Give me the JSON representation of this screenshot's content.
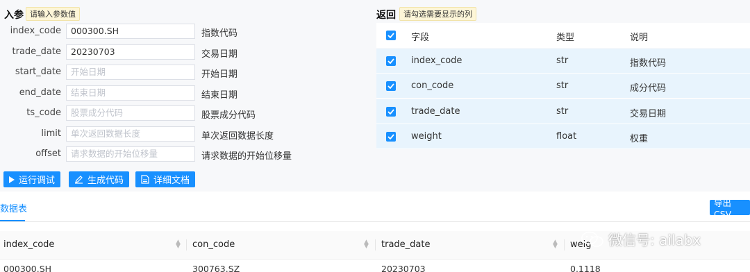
{
  "params": {
    "title": "入参",
    "hint": "请输入参数值",
    "rows": [
      {
        "label": "index_code",
        "value": "000300.SH",
        "placeholder": "",
        "desc": "指数代码"
      },
      {
        "label": "trade_date",
        "value": "20230703",
        "placeholder": "",
        "desc": "交易日期"
      },
      {
        "label": "start_date",
        "value": "",
        "placeholder": "开始日期",
        "desc": "开始日期"
      },
      {
        "label": "end_date",
        "value": "",
        "placeholder": "结束日期",
        "desc": "结束日期"
      },
      {
        "label": "ts_code",
        "value": "",
        "placeholder": "股票成分代码",
        "desc": "股票成分代码"
      },
      {
        "label": "limit",
        "value": "",
        "placeholder": "单次返回数据长度",
        "desc": "单次返回数据长度"
      },
      {
        "label": "offset",
        "value": "",
        "placeholder": "请求数据的开始位移量",
        "desc": "请求数据的开始位移量"
      }
    ]
  },
  "buttons": {
    "run": "运行调试",
    "gen": "生成代码",
    "doc": "详细文档"
  },
  "returns": {
    "title": "返回",
    "hint": "请勾选需要显示的列",
    "headers": {
      "field": "字段",
      "type": "类型",
      "desc": "说明"
    },
    "rows": [
      {
        "field": "index_code",
        "type": "str",
        "desc": "指数代码"
      },
      {
        "field": "con_code",
        "type": "str",
        "desc": "成分代码"
      },
      {
        "field": "trade_date",
        "type": "str",
        "desc": "交易日期"
      },
      {
        "field": "weight",
        "type": "float",
        "desc": "权重"
      }
    ]
  },
  "data_tab": {
    "label": "数据表",
    "export": "导出CSV",
    "columns": [
      "index_code",
      "con_code",
      "trade_date",
      "weig"
    ],
    "first_row": [
      "000300.SH",
      "300763.SZ",
      "20230703",
      "0.1118"
    ]
  },
  "watermark": "微信号: ailabx",
  "colors": {
    "accent": "#1890ff",
    "row_bg": "#e8f4fd",
    "hint_bg": "#fdf6d8"
  }
}
